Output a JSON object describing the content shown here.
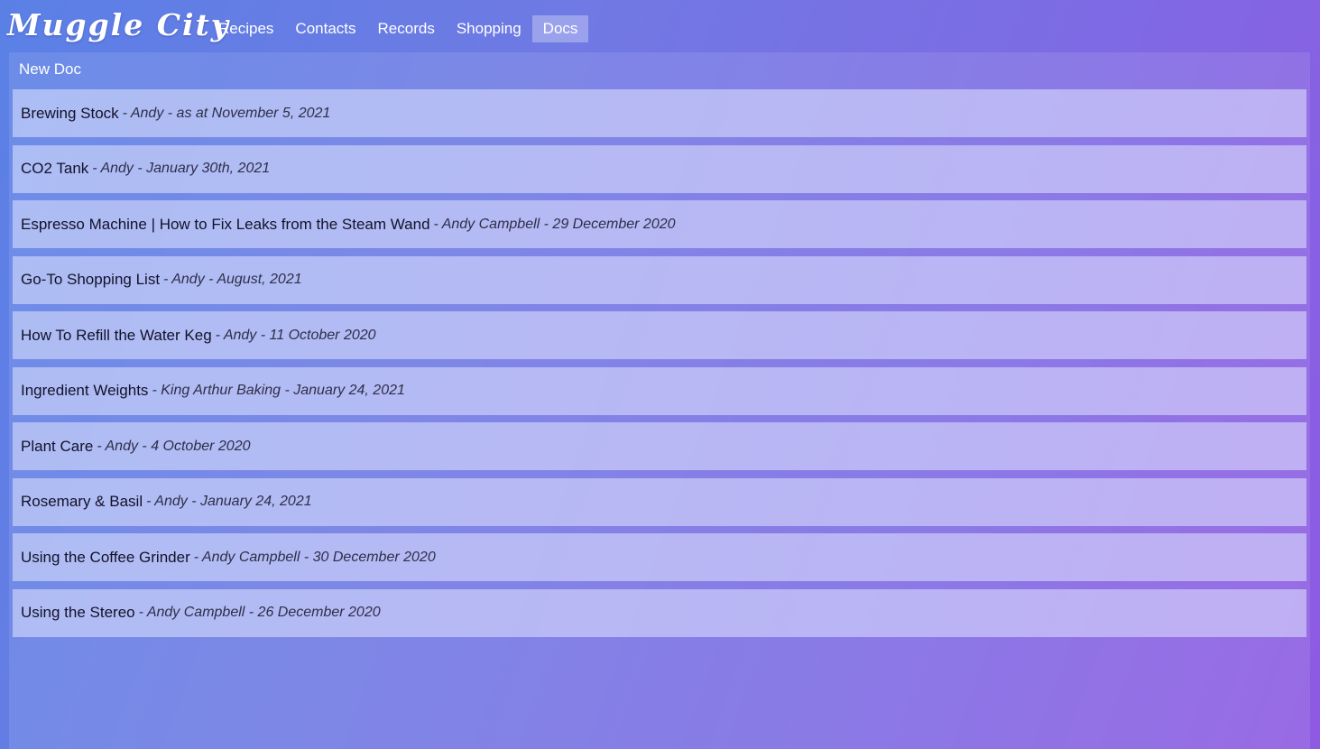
{
  "header": {
    "brand": "Muggle City",
    "nav": [
      {
        "label": "Recipes",
        "active": false
      },
      {
        "label": "Contacts",
        "active": false
      },
      {
        "label": "Records",
        "active": false
      },
      {
        "label": "Shopping",
        "active": false
      },
      {
        "label": "Docs",
        "active": true
      }
    ]
  },
  "main": {
    "new_doc_label": "New Doc",
    "docs": [
      {
        "title": "Brewing Stock",
        "meta": "- Andy - as at November 5, 2021"
      },
      {
        "title": "CO2 Tank",
        "meta": "- Andy - January 30th, 2021"
      },
      {
        "title": "Espresso Machine | How to Fix Leaks from the Steam Wand",
        "meta": "- Andy Campbell - 29 December 2020"
      },
      {
        "title": "Go-To Shopping List",
        "meta": "- Andy - August, 2021"
      },
      {
        "title": "How To Refill the Water Keg",
        "meta": "- Andy - 11 October 2020"
      },
      {
        "title": "Ingredient Weights",
        "meta": "- King Arthur Baking - January 24, 2021"
      },
      {
        "title": "Plant Care",
        "meta": "- Andy - 4 October 2020"
      },
      {
        "title": "Rosemary & Basil",
        "meta": "- Andy - January 24, 2021"
      },
      {
        "title": "Using the Coffee Grinder",
        "meta": "- Andy Campbell - 30 December 2020"
      },
      {
        "title": "Using the Stereo",
        "meta": "- Andy Campbell - 26 December 2020"
      }
    ]
  }
}
